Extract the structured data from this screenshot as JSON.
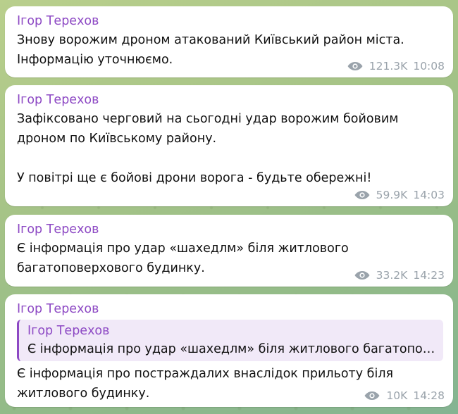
{
  "messages": [
    {
      "author": "Ігор Терехов",
      "text": "Знову ворожим дроном атакований Київський район міста.\nІнформацію уточнюємо.",
      "views": "121.3K",
      "time": "10:08"
    },
    {
      "author": "Ігор Терехов",
      "text": "Зафіксовано черговий на сьогодні удар ворожим бойовим\nдроном по Київському району.\n\nУ повітрі ще є бойові дрони ворога - будьте обережні!",
      "views": "59.9K",
      "time": "14:03"
    },
    {
      "author": "Ігор Терехов",
      "text": "Є інформація про удар «шахедлм» біля житлового\nбагатоповерхового будинку.",
      "views": "33.2K",
      "time": "14:23"
    },
    {
      "author": "Ігор Терехов",
      "reply": {
        "author": "Ігор Терехов",
        "text": "Є інформація про удар «шахедлм» біля житлового багатоповерхового будинку."
      },
      "text": "Є інформація про постраждалих внаслідок прильоту біля\nжитлового будинку.",
      "views": "10K",
      "time": "14:28"
    }
  ],
  "icons": {
    "views": "eye-icon"
  },
  "colors": {
    "author": "#8d49c4",
    "meta": "#9aa3ab",
    "bubble": "#ffffff",
    "reply_bg": "#f1e9f8"
  }
}
